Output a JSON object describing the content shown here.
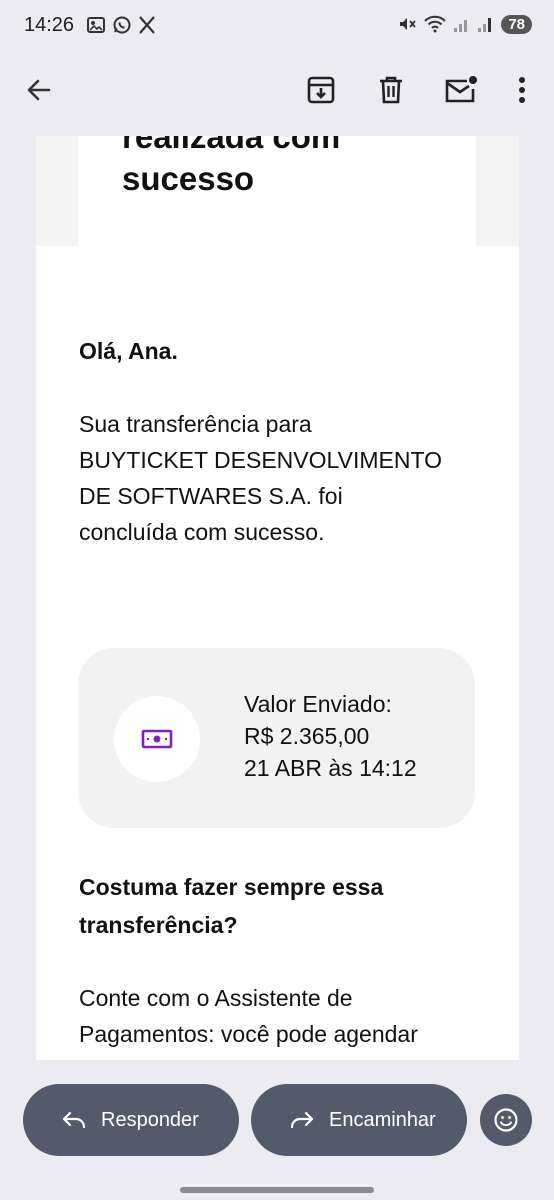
{
  "status_bar": {
    "time": "14:26",
    "battery": "78"
  },
  "email": {
    "hero_title_line1": "realizada com",
    "hero_title_line2": "sucesso",
    "greeting": "Olá, Ana.",
    "body_line1": "Sua transferência para",
    "body_line2": "BUYTICKET DESENVOLVIMENTO",
    "body_line3": "DE SOFTWARES S.A. foi",
    "body_line4": "concluída com sucesso.",
    "card": {
      "label": "Valor Enviado:",
      "amount": "R$ 2.365,00",
      "datetime": "21 ABR às 14:12",
      "icon": "money-icon",
      "icon_color": "#7b22c4"
    },
    "subhead_line1": "Costuma fazer sempre essa",
    "subhead_line2": "transferência?",
    "body2_line1": "Conte com o Assistente de",
    "body2_line2": "Pagamentos: você pode agendar"
  },
  "actions": {
    "reply_label": "Responder",
    "forward_label": "Encaminhar"
  }
}
